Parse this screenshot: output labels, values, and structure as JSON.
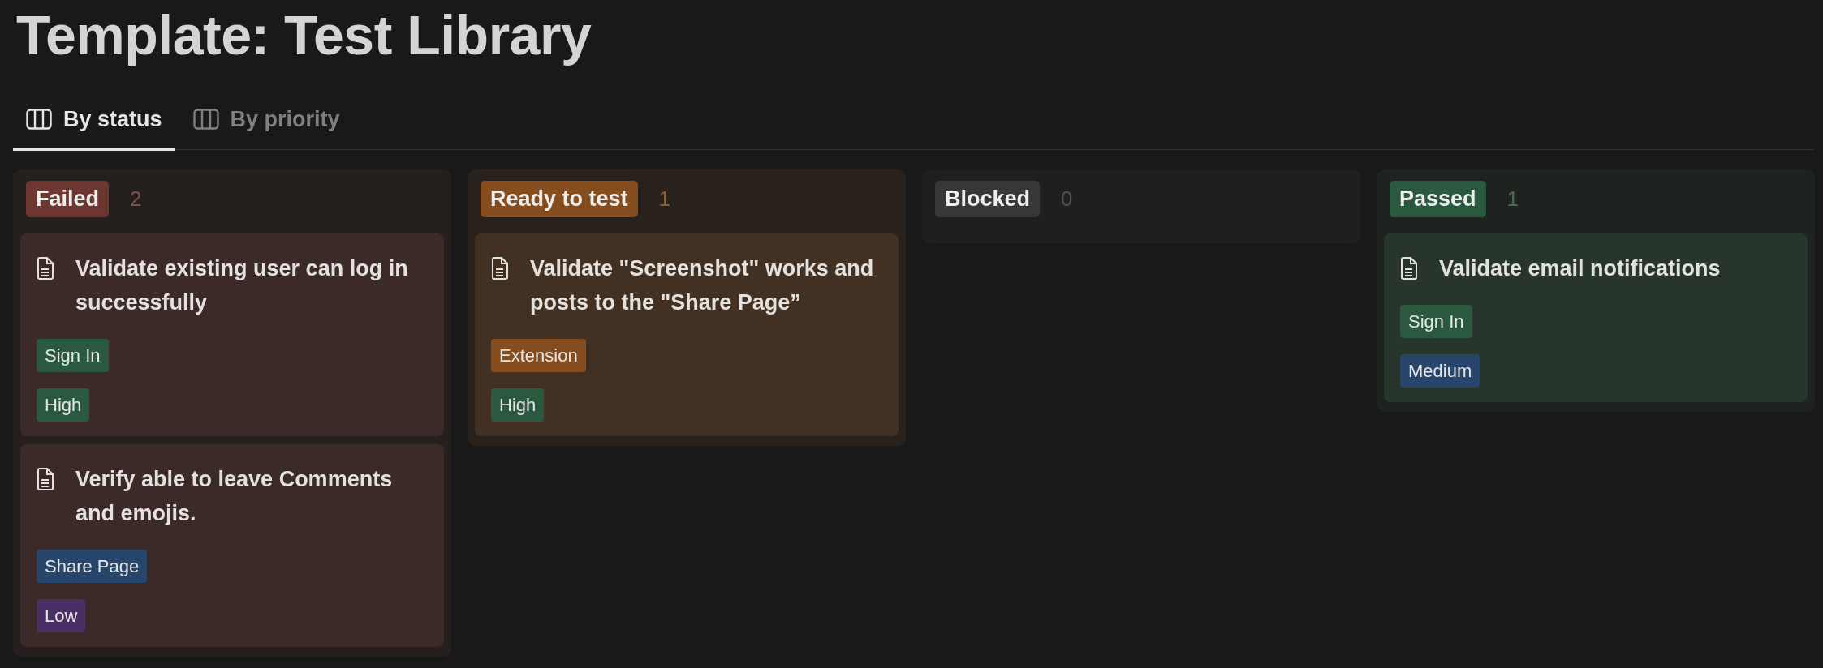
{
  "title": "Template: Test Library",
  "tabs": [
    {
      "label": "By status",
      "selected": true
    },
    {
      "label": "By priority",
      "selected": false
    }
  ],
  "columns": [
    {
      "status": "Failed",
      "color": "#6e3630",
      "count": "2",
      "cards": [
        {
          "title": "Validate existing user can log in successfully",
          "tags": [
            {
              "label": "Sign In",
              "color": "#2b593f"
            },
            {
              "label": "High",
              "color": "#2b593f"
            }
          ]
        },
        {
          "title": "Verify able to leave Comments and emojis.",
          "tags": [
            {
              "label": "Share Page",
              "color": "#28456c"
            },
            {
              "label": "Low",
              "color": "#492f64"
            }
          ]
        }
      ]
    },
    {
      "status": "Ready to test",
      "color": "#854c1d",
      "count": "1",
      "cards": [
        {
          "title": "Validate \"Screenshot\" works and posts to the \"Share Page”",
          "tags": [
            {
              "label": "Extension",
              "color": "#854c1d"
            },
            {
              "label": "High",
              "color": "#2b593f"
            }
          ]
        }
      ]
    },
    {
      "status": "Blocked",
      "color": "#373737",
      "count": "0"
    },
    {
      "status": "Passed",
      "color": "#2b593f",
      "count": "1",
      "cards": [
        {
          "title": "Validate email notifications",
          "tags": [
            {
              "label": "Sign In",
              "color": "#2b593f"
            },
            {
              "label": "Medium",
              "color": "#28456c"
            }
          ]
        }
      ]
    }
  ]
}
